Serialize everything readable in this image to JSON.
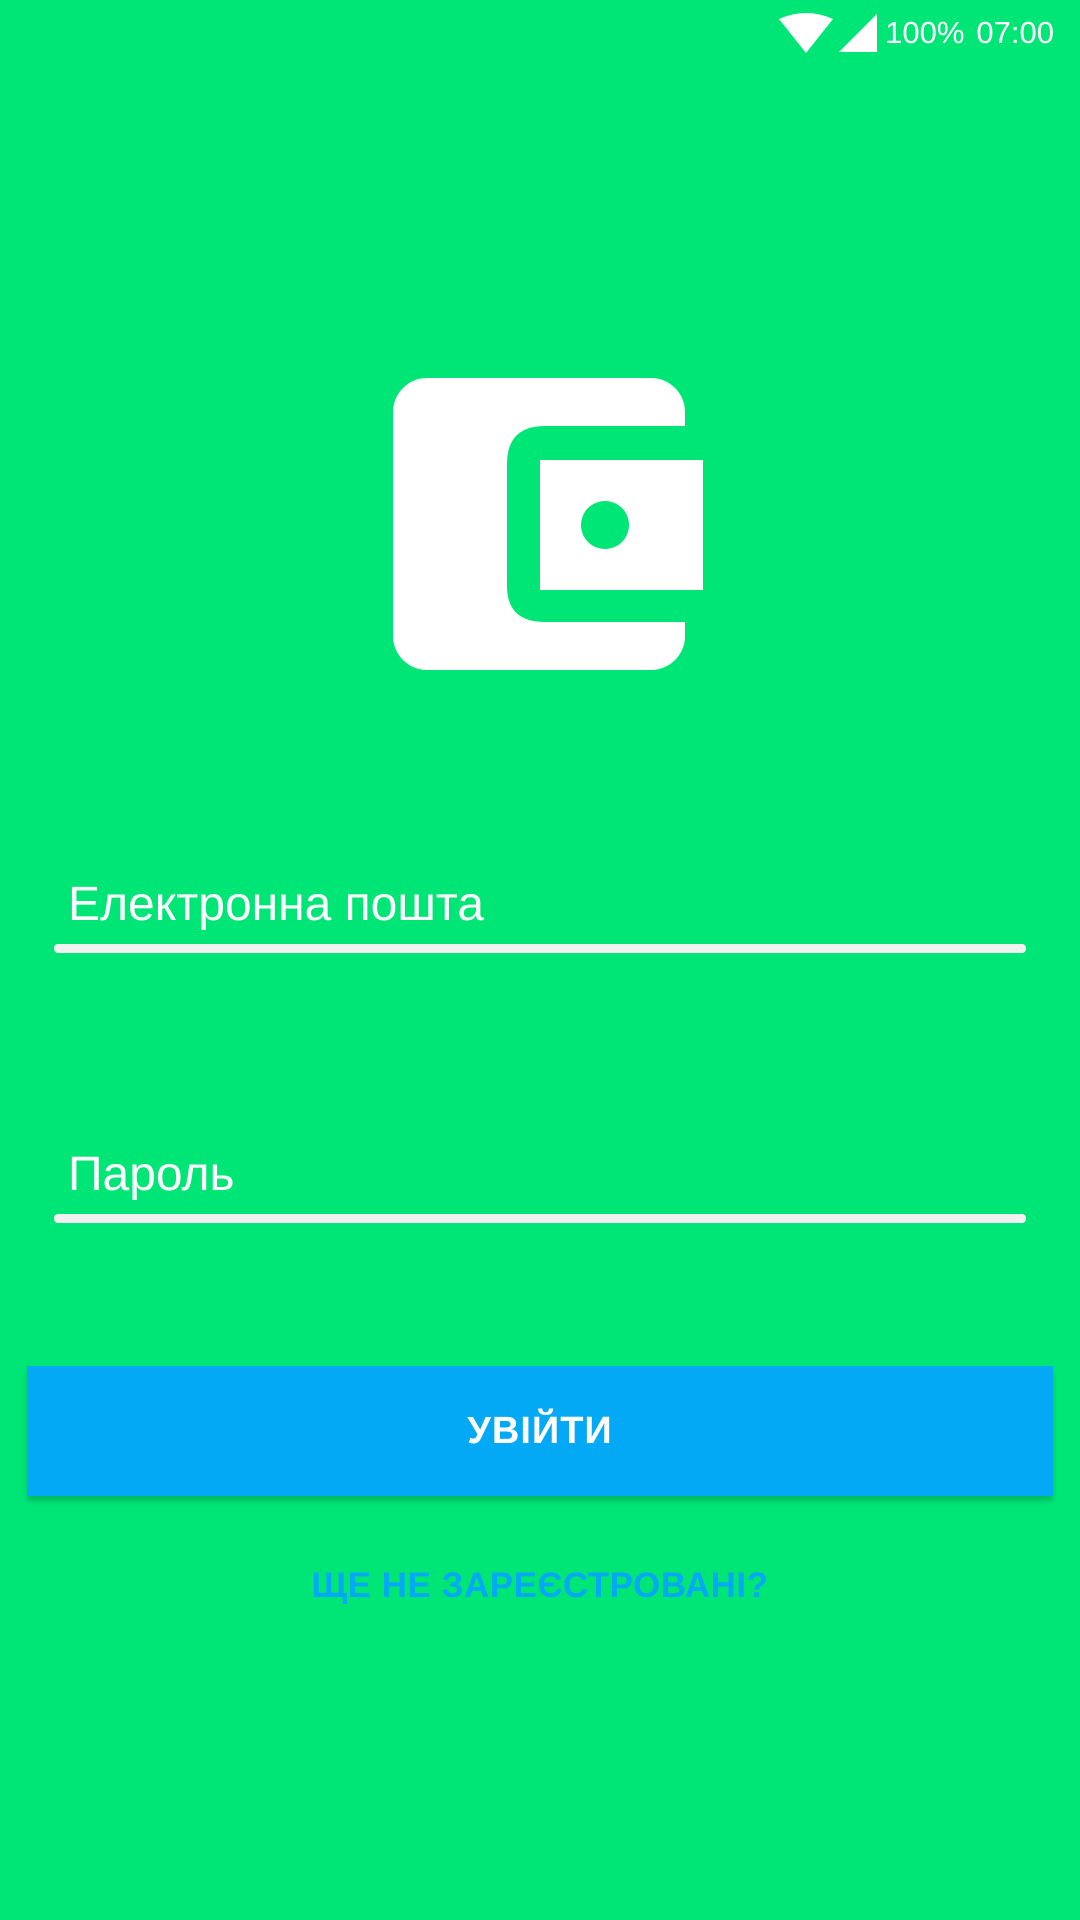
{
  "status_bar": {
    "battery": "100%",
    "time": "07:00",
    "icons": [
      "wifi-icon",
      "signal-icon"
    ]
  },
  "logo": {
    "icon": "wallet-icon"
  },
  "form": {
    "email_placeholder": "Електронна пошта",
    "password_placeholder": "Пароль",
    "login_label": "УВІЙТИ",
    "register_label": "ЩЕ НЕ ЗАРЕЄСТРОВАНІ?"
  },
  "colors": {
    "background": "#00E676",
    "accent": "#03A9F4",
    "text": "#FFFFFF"
  }
}
